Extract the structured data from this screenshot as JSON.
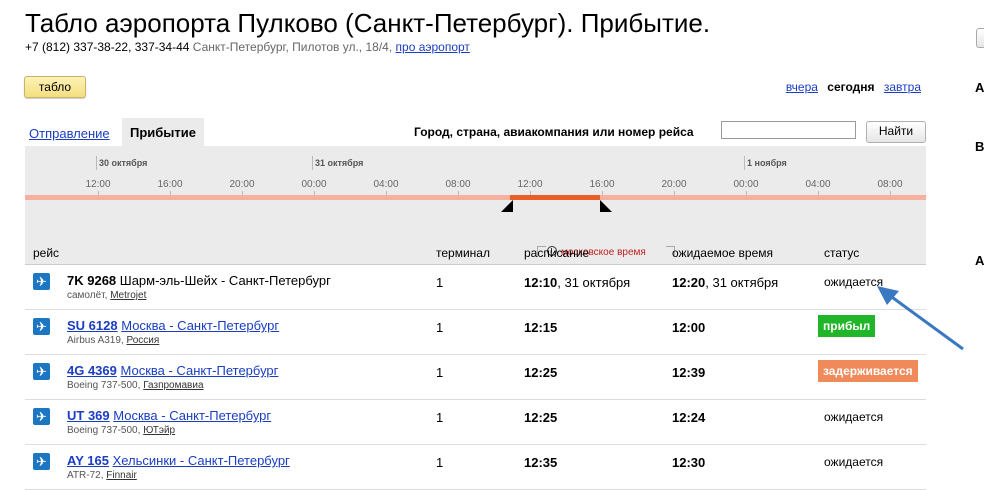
{
  "header": {
    "title": "Табло аэропорта Пулково (Санкт-Петербург). Прибытие.",
    "phones": "+7 (812) 337-38-22, 337-34-44",
    "address": "Санкт-Петербург, Пилотов ул., 18/4,",
    "about_link": "про аэропорт"
  },
  "tablo_button": "табло",
  "days": {
    "yesterday": "вчера",
    "today": "сегодня",
    "tomorrow": "завтра"
  },
  "tabs": {
    "departure": "Отправление",
    "arrival": "Прибытие"
  },
  "search": {
    "label": "Город, страна, авиакомпания или номер рейса",
    "value": "",
    "button": "Найти"
  },
  "timeline": {
    "dates": [
      "30 октября",
      "31 октября",
      "1 ноября"
    ],
    "hours": [
      "12:00",
      "16:00",
      "20:00",
      "00:00",
      "04:00",
      "08:00",
      "12:00",
      "16:00",
      "20:00",
      "00:00",
      "04:00",
      "08:00"
    ]
  },
  "table": {
    "timezone_note": "московское время",
    "columns": {
      "flight": "рейс",
      "terminal": "терминал",
      "schedule": "расписание",
      "expected": "ожидаемое время",
      "status": "статус"
    },
    "rows": [
      {
        "code": "7K 9268",
        "route": "Шарм-эль-Шейх - Санкт-Петербург",
        "aircraft": "самолёт,",
        "airline": "Metrojet",
        "terminal": "1",
        "sched_time": "12:10",
        "sched_date": ", 31 октября",
        "exp_time": "12:20",
        "exp_date": ", 31 октября",
        "status": "ожидается"
      },
      {
        "code": "SU 6128",
        "route": "Москва - Санкт-Петербург",
        "aircraft": "Airbus A319,",
        "airline": "Россия",
        "terminal": "1",
        "sched_time": "12:15",
        "sched_date": "",
        "exp_time": "12:00",
        "exp_date": "",
        "status": "прибыл"
      },
      {
        "code": "4G 4369",
        "route": "Москва - Санкт-Петербург",
        "aircraft": "Boeing 737-500,",
        "airline": "Газпромавиа",
        "terminal": "1",
        "sched_time": "12:25",
        "sched_date": "",
        "exp_time": "12:39",
        "exp_date": "",
        "status": "задерживается"
      },
      {
        "code": "UT 369",
        "route": "Москва - Санкт-Петербург",
        "aircraft": "Boeing 737-500,",
        "airline": "ЮТэйр",
        "terminal": "1",
        "sched_time": "12:25",
        "sched_date": "",
        "exp_time": "12:24",
        "exp_date": "",
        "status": "ожидается"
      },
      {
        "code": "AY 165",
        "route": "Хельсинки - Санкт-Петербург",
        "aircraft": "ATR-72,",
        "airline": "Finnair",
        "terminal": "1",
        "sched_time": "12:35",
        "sched_date": "",
        "exp_time": "12:30",
        "exp_date": "",
        "status": "ожидается"
      }
    ]
  },
  "right_edge_letters": [
    "А",
    "В",
    "А"
  ],
  "colors": {
    "arrived": "#21b529",
    "delayed": "#f18a5b",
    "link": "#1a3dc1",
    "icon": "#1d76c2",
    "arrow": "#3a78c2"
  }
}
